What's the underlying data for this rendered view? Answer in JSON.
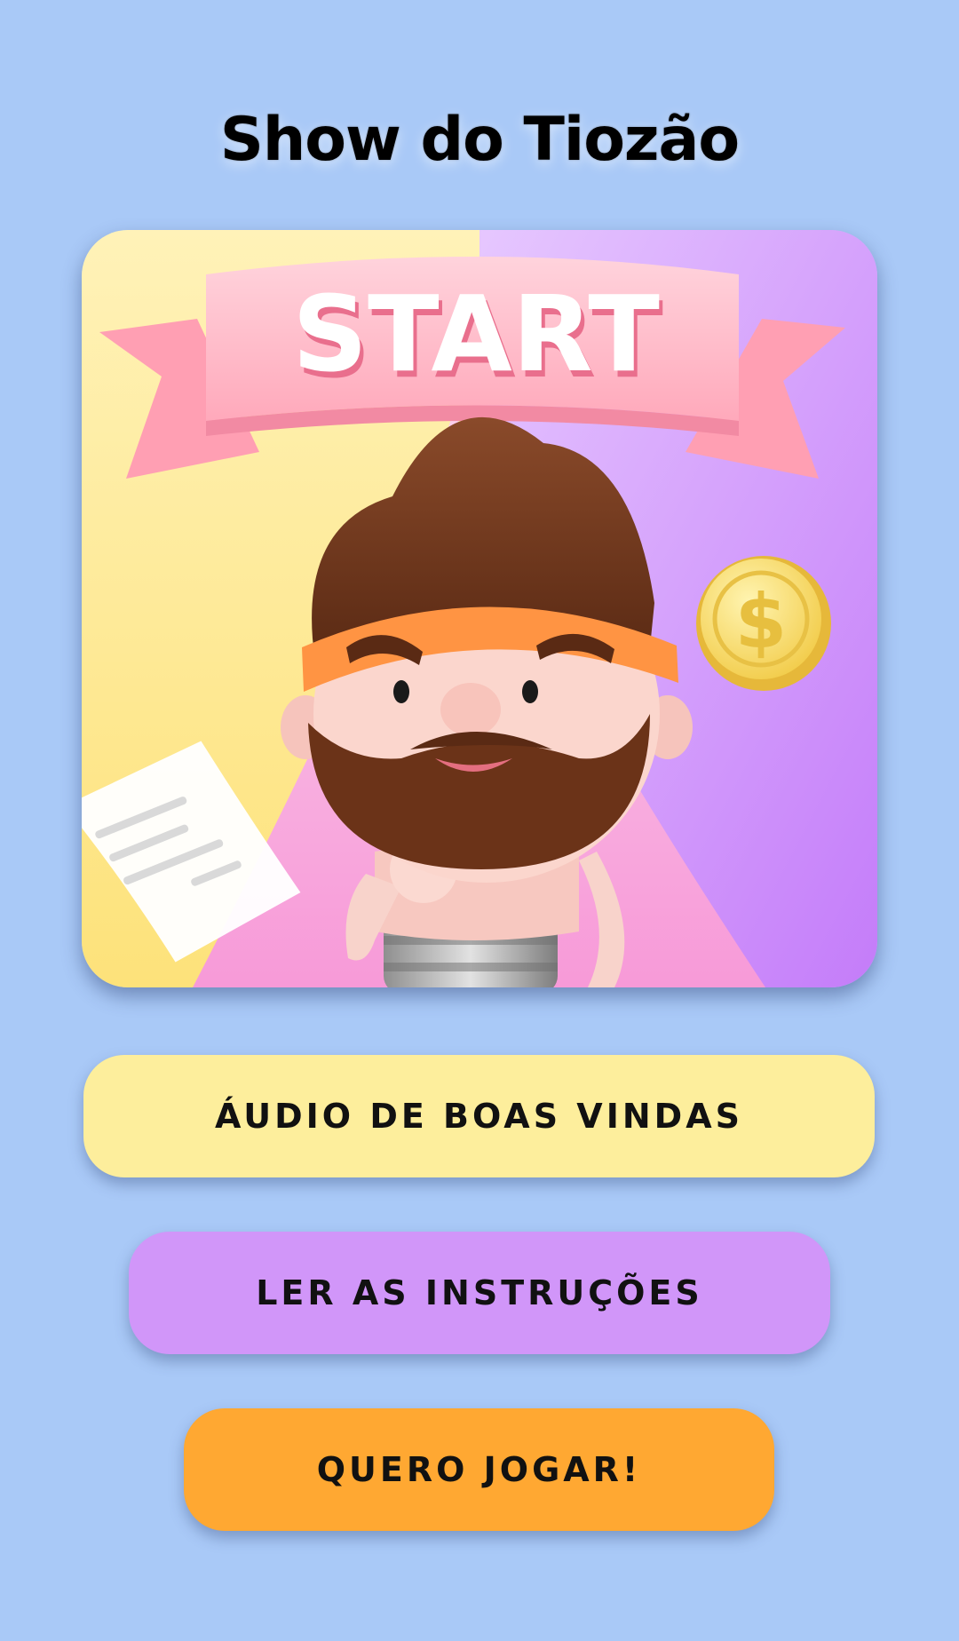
{
  "app": {
    "title": "Show do Tiozão"
  },
  "hero": {
    "banner_text": "START",
    "coin_symbol": "$"
  },
  "buttons": {
    "welcome_audio": "ÁUDIO DE BOAS VINDAS",
    "read_instructions": "LER AS INSTRUÇÕES",
    "play": "QUERO JOGAR!"
  },
  "colors": {
    "background": "#a9c9f7",
    "welcome_button": "#fdee9c",
    "instructions_button": "#d196f9",
    "play_button": "#ffa832"
  }
}
